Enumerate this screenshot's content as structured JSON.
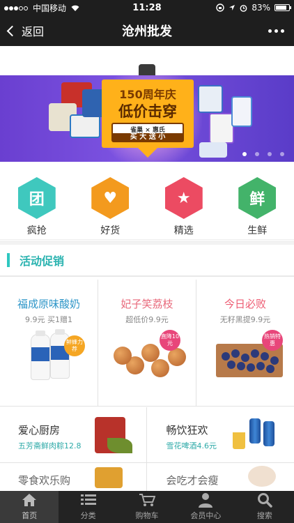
{
  "status": {
    "carrier": "中国移动",
    "time": "11:28",
    "battery": "83%",
    "battery_level": 0.83
  },
  "nav": {
    "back_label": "返回",
    "title": "沧州批发"
  },
  "banner": {
    "headline": "150周年庆",
    "slogan": "低价击穿",
    "brands": "雀巢 × 惠氏",
    "offer": "买 大 送 小",
    "colors": {
      "bg": "#6a3fd0",
      "sign": "#ffb11a"
    }
  },
  "categories": [
    {
      "icon": "团",
      "label": "疯抢",
      "color": "#3fc8be"
    },
    {
      "icon": "♥",
      "label": "好货",
      "color": "#f39a1e"
    },
    {
      "icon": "★",
      "label": "精选",
      "color": "#ec4b62"
    },
    {
      "icon": "鲜",
      "label": "生鲜",
      "color": "#43b36a"
    }
  ],
  "section": {
    "title": "活动促销"
  },
  "promos": [
    {
      "title": "福成原味酸奶",
      "subtitle": "9.9元 买1赠1",
      "badge": "鲜蜂力荐",
      "title_color": "#2e96c8"
    },
    {
      "title": "妃子笑荔枝",
      "subtitle": "超低价9.9元",
      "badge": "直降10元",
      "title_color": "#e8687a"
    },
    {
      "title": "今日必败",
      "subtitle": "无籽黑提9.9元",
      "badge": "热销特惠",
      "title_color": "#ee5b72"
    }
  ],
  "promos2": [
    {
      "title": "爱心厨房",
      "subtitle": "五芳斋鲜肉粽12.8"
    },
    {
      "title": "畅饮狂欢",
      "subtitle": "雪花啤酒4.6元"
    },
    {
      "title": "零食欢乐购",
      "subtitle": ""
    },
    {
      "title": "会吃才会瘦",
      "subtitle": ""
    }
  ],
  "tabs": [
    {
      "label": "首页",
      "icon": "home-icon"
    },
    {
      "label": "分类",
      "icon": "list-icon"
    },
    {
      "label": "购物车",
      "icon": "cart-icon"
    },
    {
      "label": "会员中心",
      "icon": "user-icon"
    },
    {
      "label": "搜索",
      "icon": "search-icon"
    }
  ]
}
